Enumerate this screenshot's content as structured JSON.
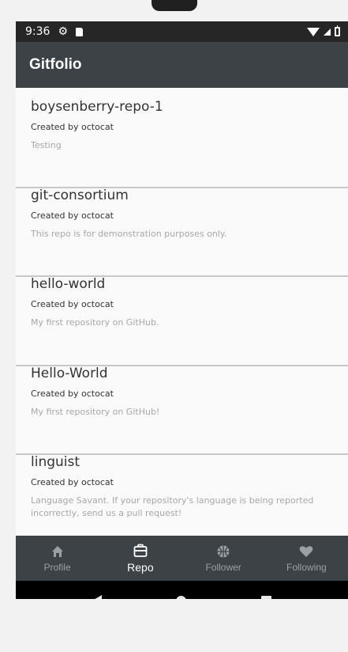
{
  "status_bar": {
    "time": "9:36",
    "icons": [
      "gear-icon",
      "sd-card-icon",
      "wifi-icon",
      "signal-icon",
      "battery-icon"
    ]
  },
  "app_bar": {
    "title": "Gitfolio"
  },
  "repos": [
    {
      "name": "boysenberry-repo-1",
      "creator": "Created by octocat",
      "description": "Testing"
    },
    {
      "name": "git-consortium",
      "creator": "Created by octocat",
      "description": "This repo is for demonstration purposes only."
    },
    {
      "name": "hello-world",
      "creator": "Created by octocat",
      "description": "My first repository on GitHub."
    },
    {
      "name": "Hello-World",
      "creator": "Created by octocat",
      "description": "My first repository on GitHub!"
    },
    {
      "name": "linguist",
      "creator": "Created by octocat",
      "description": "Language Savant. If your repository's language is being reported incorrectly, send us a pull request!"
    }
  ],
  "bottom_nav": {
    "active": "Repo",
    "items": [
      {
        "label": "Profile",
        "icon": "home-icon"
      },
      {
        "label": "Repo",
        "icon": "briefcase-icon"
      },
      {
        "label": "Follower",
        "icon": "basketball-icon"
      },
      {
        "label": "Following",
        "icon": "heart-icon"
      }
    ]
  },
  "system_nav": {
    "buttons": [
      "back",
      "home",
      "recents"
    ]
  },
  "colors": {
    "app_bar": "#3d4246",
    "status_bar": "#262626",
    "nav_active": "#ffffff",
    "nav_inactive": "#9aa0a4",
    "description_text": "#a8a8a8"
  }
}
